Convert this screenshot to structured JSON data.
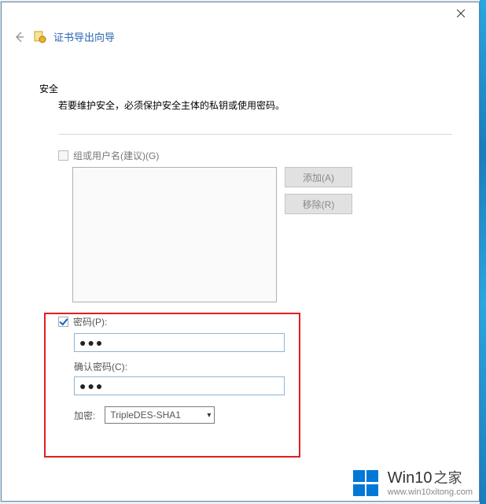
{
  "window": {
    "title": "证书导出向导",
    "close_icon": "close-icon"
  },
  "section": {
    "heading": "安全",
    "description": "若要维护安全，必须保护安全主体的私钥或使用密码。"
  },
  "group": {
    "checkbox_label": "组或用户名(建议)(G)",
    "add_btn": "添加(A)",
    "remove_btn": "移除(R)"
  },
  "password": {
    "checkbox_label": "密码(P):",
    "value": "●●●",
    "confirm_label": "确认密码(C):",
    "confirm_value": "●●●"
  },
  "encryption": {
    "label": "加密:",
    "selected": "TripleDES-SHA1"
  },
  "watermark": {
    "brand_main": "Win10",
    "brand_suffix": "之家",
    "url": "www.win10xitong.com"
  }
}
